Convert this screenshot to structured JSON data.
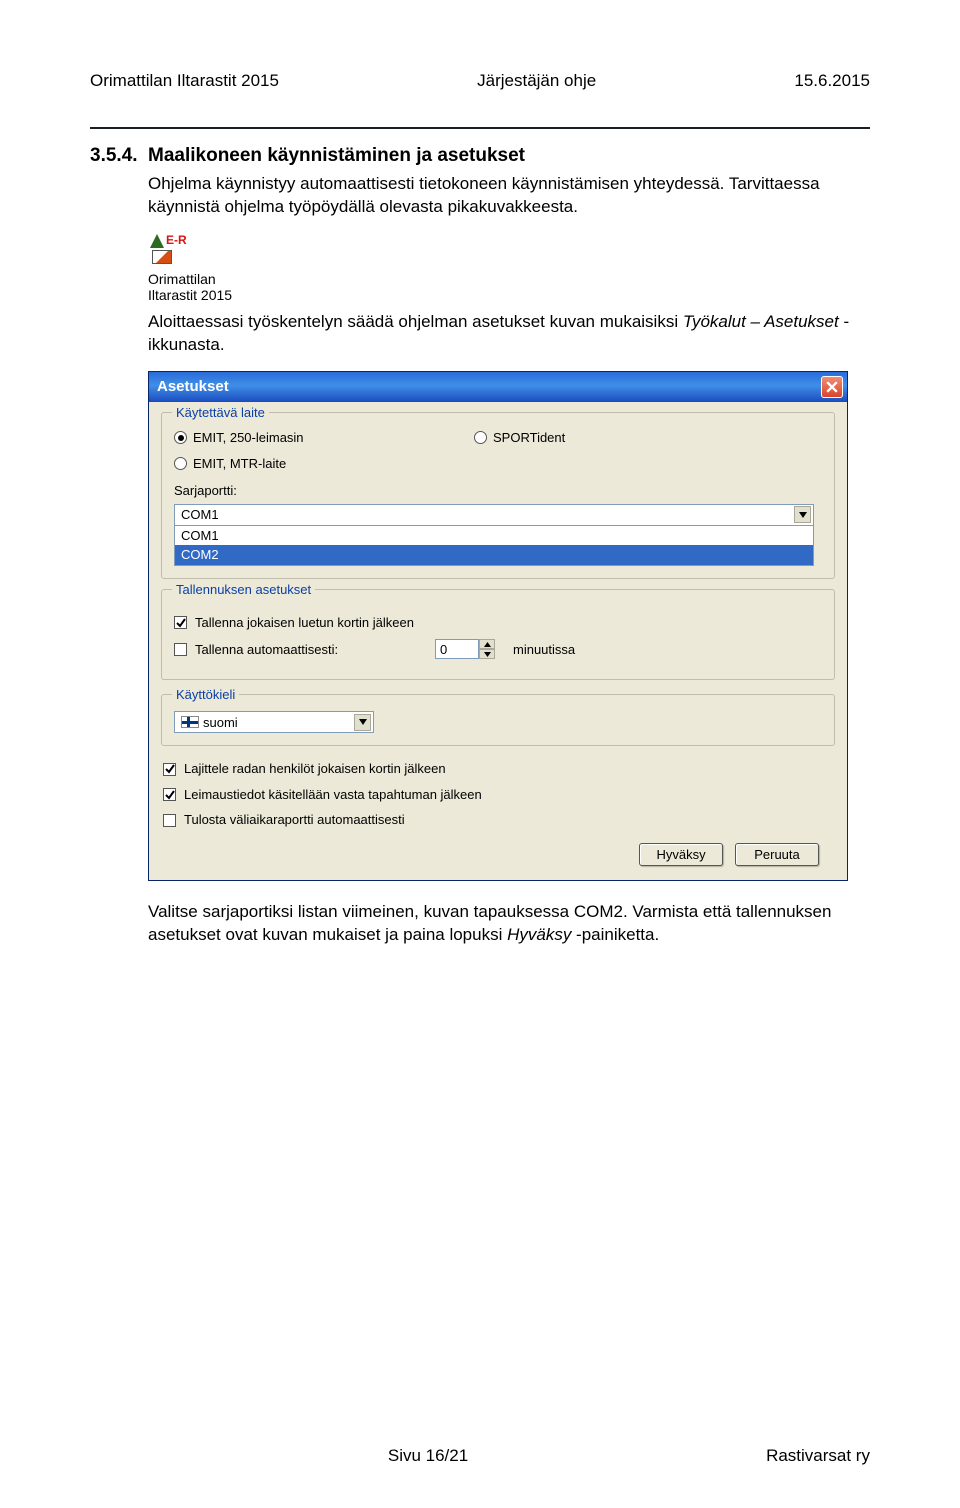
{
  "header": {
    "left": "Orimattilan Iltarastit 2015",
    "center": "Järjestäjän ohje",
    "right": "15.6.2015"
  },
  "section": {
    "number": "3.5.4.",
    "title": "Maalikoneen käynnistäminen ja asetukset",
    "para1": "Ohjelma käynnistyy automaattisesti tietokoneen käynnistämisen yhteydessä. Tarvittaessa käynnistä ohjelma työpöydällä olevasta pikakuvakkeesta.",
    "para2_pre": "Aloittaessasi työskentelyn säädä ohjelman asetukset kuvan mukaisiksi ",
    "para2_em": "Työkalut – Asetukset",
    "para2_post": " -ikkunasta.",
    "para3_pre": "Valitse sarjaportiksi listan viimeinen, kuvan tapauksessa COM2. Varmista että tallennuksen asetukset ovat kuvan mukaiset ja paina lopuksi ",
    "para3_em": "Hyväksy",
    "para3_post": " -painiketta."
  },
  "app_icon": {
    "line1": "Orimattilan",
    "line2": "Iltarastit 2015",
    "er": "E-R"
  },
  "dialog": {
    "title": "Asetukset",
    "group_device": {
      "legend": "Käytettävä laite",
      "opt_emit_250": "EMIT, 250-leimasin",
      "opt_sportident": "SPORTident",
      "opt_emit_mtr": "EMIT, MTR-laite",
      "port_label": "Sarjaportti:",
      "port_selected": "COM1",
      "port_options": {
        "0": "COM1",
        "1": "COM2"
      }
    },
    "group_save": {
      "legend": "Tallennuksen asetukset",
      "chk_every_card": "Tallenna jokaisen luetun kortin jälkeen",
      "chk_auto": "Tallenna automaattisesti:",
      "auto_value": "0",
      "auto_unit": "minuutissa"
    },
    "group_lang": {
      "legend": "Käyttökieli",
      "value": "suomi"
    },
    "chk_sort": "Lajittele radan henkilöt jokaisen kortin jälkeen",
    "chk_stamp": "Leimaustiedot käsitellään vasta tapahtuman jälkeen",
    "chk_report": "Tulosta väliaikaraportti automaattisesti",
    "btn_ok": "Hyväksy",
    "btn_cancel": "Peruuta"
  },
  "footer": {
    "center": "Sivu 16/21",
    "right": "Rastivarsat ry"
  }
}
